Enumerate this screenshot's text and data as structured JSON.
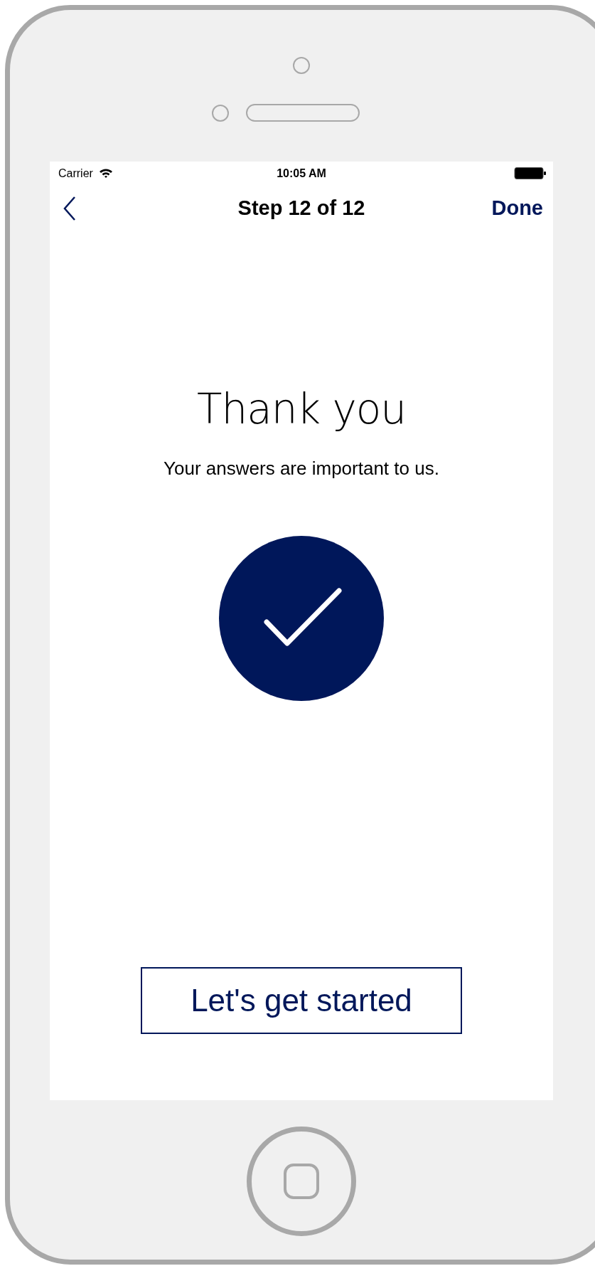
{
  "status_bar": {
    "carrier": "Carrier",
    "time": "10:05 AM"
  },
  "nav": {
    "title": "Step 12 of 12",
    "done": "Done"
  },
  "heading": "Thank you",
  "subtitle": "Your answers are important to us.",
  "button": {
    "label": "Let's get started"
  }
}
